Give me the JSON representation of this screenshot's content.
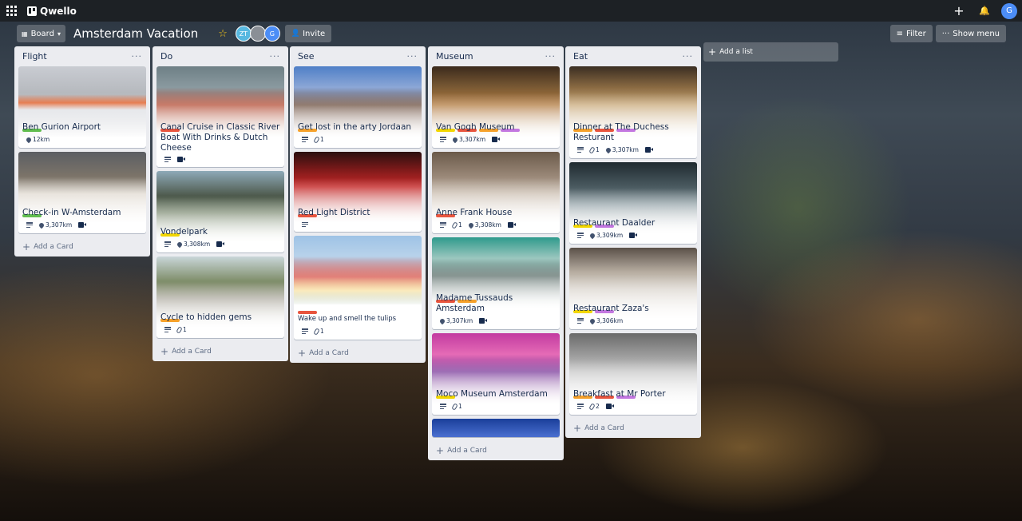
{
  "app": {
    "name": "Qwello",
    "user_initial": "G"
  },
  "board": {
    "view_label": "Board",
    "title": "Amsterdam Vacation",
    "members": [
      "ZT",
      "",
      "G"
    ],
    "invite_label": "Invite",
    "filter_label": "Filter",
    "show_menu_label": "Show menu",
    "add_list_label": "Add a list"
  },
  "colors": {
    "green": "#61bd4f",
    "orange": "#f6a12a",
    "red": "#e8553e",
    "yellow": "#f2d600",
    "purple": "#c377e0"
  },
  "lists": [
    {
      "title": "Flight",
      "add_card_label": "Add a Card",
      "cards": [
        {
          "title": "Ben Gurion Airport",
          "labels": [
            "#61bd4f"
          ],
          "badges": {
            "location": "12km"
          }
        },
        {
          "title": "Check-in W-Amsterdam",
          "labels": [
            "#61bd4f"
          ],
          "badges": {
            "description": true,
            "location": "3,307km",
            "video": true
          }
        }
      ]
    },
    {
      "title": "Do",
      "add_card_label": "Add a Card",
      "cards": [
        {
          "title": "Canal Cruise in Classic River Boat With Drinks & Dutch Cheese",
          "labels": [
            "#e8553e"
          ],
          "badges": {
            "description": true,
            "video": true
          }
        },
        {
          "title": "Vondelpark",
          "labels": [
            "#f2d600"
          ],
          "badges": {
            "description": true,
            "location": "3,308km",
            "video": true
          }
        },
        {
          "title": "Cycle to hidden gems",
          "labels": [
            "#f6a12a"
          ],
          "badges": {
            "description": true,
            "attachments": "1"
          }
        }
      ]
    },
    {
      "title": "See",
      "add_card_label": "Add a Card",
      "cards": [
        {
          "title": "Get lost in the arty Jordaan",
          "labels": [
            "#f6a12a"
          ],
          "badges": {
            "description": true,
            "attachments": "1"
          }
        },
        {
          "title": "Red Light District",
          "labels": [
            "#e8553e"
          ],
          "badges": {
            "description": true
          }
        },
        {
          "title": "Wake up and smell the tulips",
          "labels": [
            "#e8553e"
          ],
          "badges": {
            "description": true,
            "attachments": "1"
          }
        }
      ]
    },
    {
      "title": "Museum",
      "add_card_label": "Add a Card",
      "cards": [
        {
          "title": "Van Gogh Museum",
          "labels": [
            "#f2d600",
            "#e8553e",
            "#f6a12a",
            "#c377e0"
          ],
          "badges": {
            "description": true,
            "location": "3,307km",
            "video": true
          }
        },
        {
          "title": "Anne Frank House",
          "labels": [
            "#e8553e"
          ],
          "badges": {
            "description": true,
            "attachments": "1",
            "location": "3,308km",
            "video": true
          }
        },
        {
          "title": "Madame Tussauds Amsterdam",
          "labels": [
            "#e8553e",
            "#f6a12a"
          ],
          "badges": {
            "location": "3,307km",
            "video": true
          }
        },
        {
          "title": "Moco Museum Amsterdam",
          "labels": [
            "#f2d600"
          ],
          "badges": {
            "description": true,
            "attachments": "1"
          }
        }
      ]
    },
    {
      "title": "Eat",
      "add_card_label": "Add a Card",
      "cards": [
        {
          "title": "Dinner at The Duchess Resturant",
          "labels": [
            "#f6a12a",
            "#e8553e",
            "#c377e0"
          ],
          "badges": {
            "description": true,
            "attachments": "1",
            "location": "3,307km",
            "video": true
          }
        },
        {
          "title": "Restaurant Daalder",
          "labels": [
            "#f2d600",
            "#c377e0"
          ],
          "badges": {
            "description": true,
            "location": "3,309km",
            "video": true
          }
        },
        {
          "title": "Restaurant Zaza's",
          "labels": [
            "#f2d600",
            "#c377e0"
          ],
          "badges": {
            "description": true,
            "location": "3,306km"
          }
        },
        {
          "title": "Breakfast at Mr Porter",
          "labels": [
            "#f6a12a",
            "#e8553e",
            "#c377e0"
          ],
          "badges": {
            "description": true,
            "attachments": "2",
            "video": true
          }
        }
      ]
    }
  ]
}
